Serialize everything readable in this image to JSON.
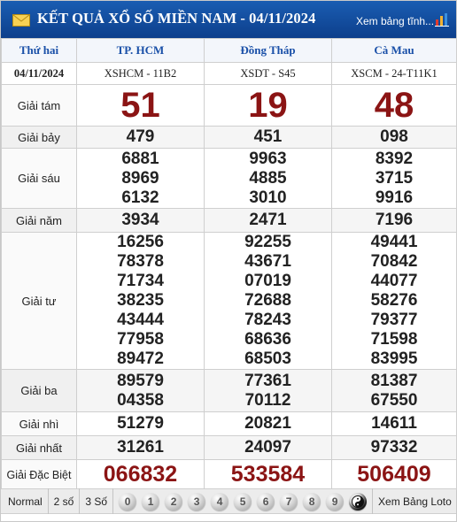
{
  "header": {
    "title": "KẾT QUẢ XỔ SỐ MIỀN NAM - 04/11/2024",
    "link_label": "Xem bảng tĩnh...",
    "bg_color": "#1552a3"
  },
  "table": {
    "day_label": "Thứ hai",
    "date_label": "04/11/2024",
    "provinces": [
      "TP. HCM",
      "Đồng Tháp",
      "Cà Mau"
    ],
    "codes": [
      "XSHCM - 11B2",
      "XSDT - S45",
      "XSCM - 24-T11K1"
    ],
    "prizes": [
      {
        "label": "Giải tám",
        "values": [
          [
            "51"
          ],
          [
            "19"
          ],
          [
            "48"
          ]
        ]
      },
      {
        "label": "Giải bảy",
        "values": [
          [
            "479"
          ],
          [
            "451"
          ],
          [
            "098"
          ]
        ]
      },
      {
        "label": "Giải sáu",
        "values": [
          [
            "6881",
            "8969",
            "6132"
          ],
          [
            "9963",
            "4885",
            "3010"
          ],
          [
            "8392",
            "3715",
            "9916"
          ]
        ]
      },
      {
        "label": "Giải năm",
        "values": [
          [
            "3934"
          ],
          [
            "2471"
          ],
          [
            "7196"
          ]
        ]
      },
      {
        "label": "Giải tư",
        "values": [
          [
            "16256",
            "78378",
            "71734",
            "38235",
            "43444",
            "77958",
            "89472"
          ],
          [
            "92255",
            "43671",
            "07019",
            "72688",
            "78243",
            "68636",
            "68503"
          ],
          [
            "49441",
            "70842",
            "44077",
            "58276",
            "79377",
            "71598",
            "83995"
          ]
        ]
      },
      {
        "label": "Giải ba",
        "values": [
          [
            "89579",
            "04358"
          ],
          [
            "77361",
            "70112"
          ],
          [
            "81387",
            "67550"
          ]
        ]
      },
      {
        "label": "Giải nhì",
        "values": [
          [
            "51279"
          ],
          [
            "20821"
          ],
          [
            "14611"
          ]
        ]
      },
      {
        "label": "Giải nhất",
        "values": [
          [
            "31261"
          ],
          [
            "24097"
          ],
          [
            "97332"
          ]
        ]
      },
      {
        "label": "Giải Đặc Biệt",
        "values": [
          [
            "066832"
          ],
          [
            "533584"
          ],
          [
            "506409"
          ]
        ]
      }
    ],
    "highlight_color": "#8b1414"
  },
  "footer": {
    "options": [
      "Normal",
      "2 số",
      "3 Số"
    ],
    "balls": [
      "0",
      "1",
      "2",
      "3",
      "4",
      "5",
      "6",
      "7",
      "8",
      "9"
    ],
    "loto_label": "Xem Bảng Loto"
  }
}
